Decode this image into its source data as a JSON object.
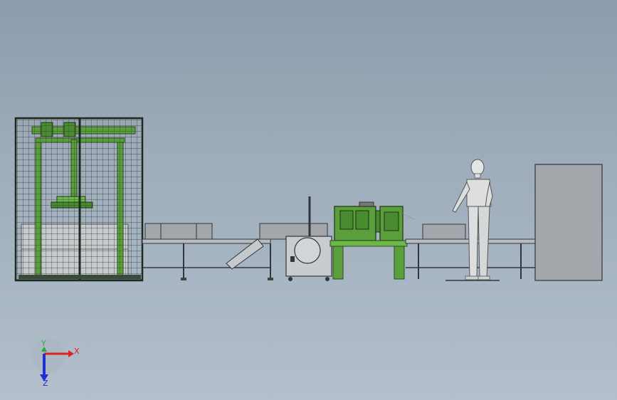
{
  "viewport": {
    "background_top": "#8d9bac",
    "background_bottom": "#b3bfcb"
  },
  "colors": {
    "frame_green": "#5aa03a",
    "frame_dark": "#2f4a22",
    "conveyor_gray": "#b8bcc0",
    "box_gray": "#a3a7ab",
    "machine_gray": "#c9ccce",
    "outline": "#30363c",
    "axis_x": "#e02020",
    "axis_y": "#20b030",
    "axis_z": "#2030d0"
  },
  "triad": {
    "x_label": "X",
    "y_label": "Y",
    "z_label": "Z"
  }
}
